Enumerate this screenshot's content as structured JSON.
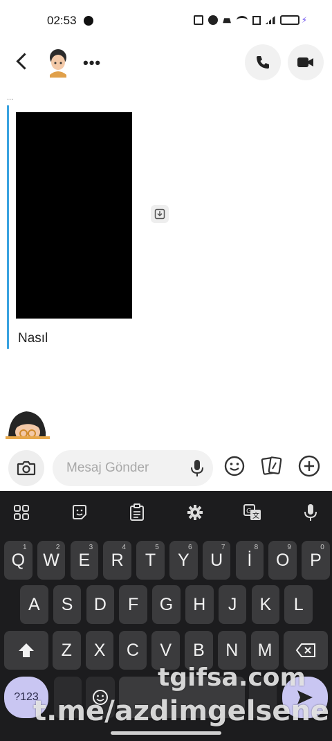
{
  "status_bar": {
    "time": "02:53",
    "icons": [
      "nfc-icon",
      "alarm-icon",
      "mute-icon",
      "wifi-icon",
      "sim-icon",
      "signal-icon",
      "battery-icon",
      "charging-icon"
    ]
  },
  "header": {
    "more_label": "•••",
    "icons": [
      "back-icon",
      "avatar",
      "phone-icon",
      "video-icon"
    ]
  },
  "chat": {
    "small_dots": "...",
    "message_text": "Nasıl"
  },
  "composer": {
    "placeholder": "Mesaj Gönder",
    "icons": [
      "camera-icon",
      "mic-icon",
      "emoji-icon",
      "cards-icon",
      "plus-icon"
    ]
  },
  "keyboard": {
    "toolbar_icons": [
      "apps-grid-icon",
      "sticker-icon",
      "clipboard-icon",
      "settings-icon",
      "translate-icon",
      "mic-icon"
    ],
    "row1": [
      {
        "k": "Q",
        "s": "1"
      },
      {
        "k": "W",
        "s": "2"
      },
      {
        "k": "E",
        "s": "3"
      },
      {
        "k": "R",
        "s": "4"
      },
      {
        "k": "T",
        "s": "5"
      },
      {
        "k": "Y",
        "s": "6"
      },
      {
        "k": "U",
        "s": "7"
      },
      {
        "k": "İ",
        "s": "8"
      },
      {
        "k": "O",
        "s": "9"
      },
      {
        "k": "P",
        "s": "0"
      }
    ],
    "row2": [
      "A",
      "S",
      "D",
      "F",
      "G",
      "H",
      "J",
      "K",
      "L"
    ],
    "row3": [
      "Z",
      "X",
      "C",
      "V",
      "B",
      "N",
      "M"
    ],
    "symbols_label": "?123",
    "accent": "#c9c6f2"
  },
  "watermark": {
    "line1": "tgifsa.com",
    "line2": "t.me/azdimgelsene"
  }
}
